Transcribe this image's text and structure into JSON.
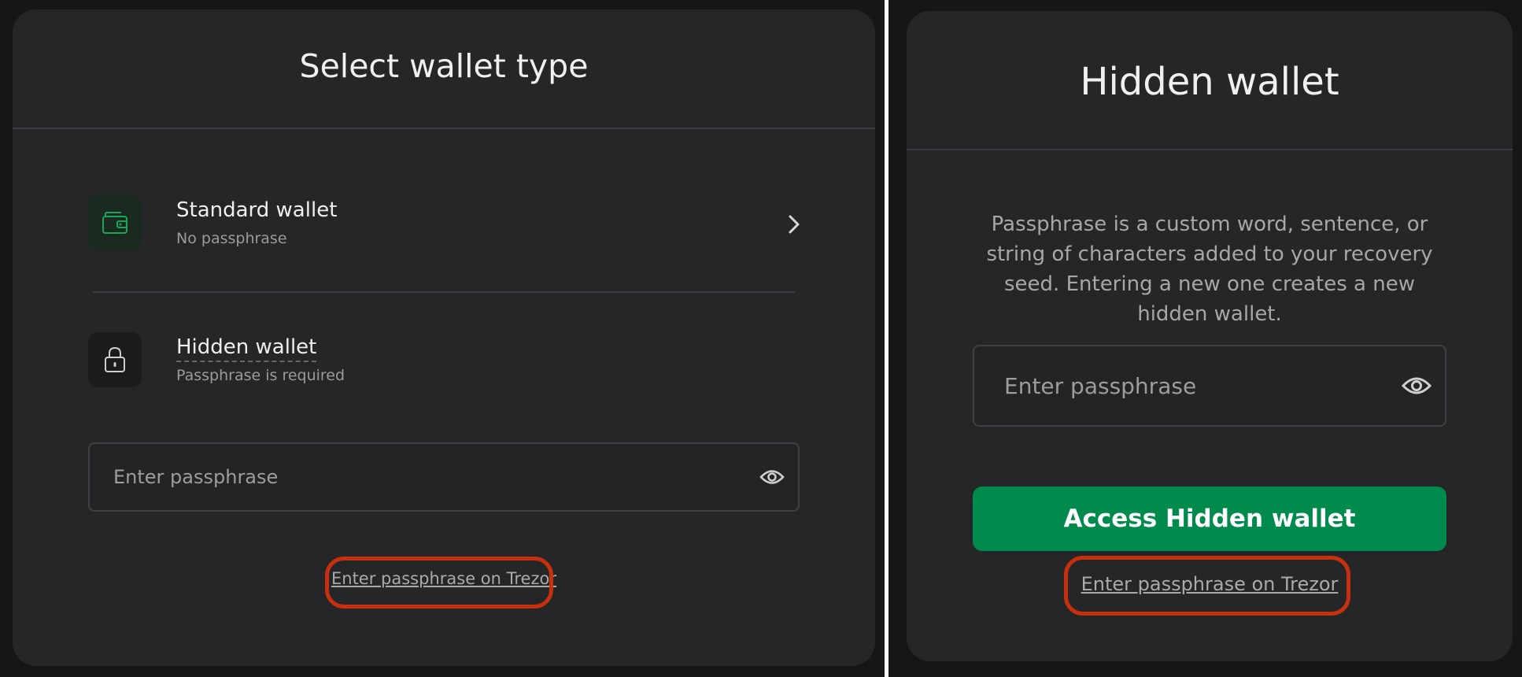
{
  "left_panel": {
    "title": "Select wallet type",
    "standard_wallet": {
      "name": "Standard wallet",
      "subtitle": "No passphrase",
      "icon": "wallet-icon"
    },
    "hidden_wallet": {
      "name": "Hidden wallet",
      "subtitle": "Passphrase is required",
      "icon": "lock-icon"
    },
    "passphrase_input": {
      "placeholder": "Enter passphrase",
      "value": ""
    },
    "trezor_link": "Enter passphrase on Trezor"
  },
  "right_panel": {
    "title": "Hidden wallet",
    "description": "Passphrase is a custom word, sentence, or string of characters added to your recovery seed. Entering a new one creates a new hidden wallet.",
    "passphrase_input": {
      "placeholder": "Enter passphrase",
      "value": ""
    },
    "access_button": "Access Hidden wallet",
    "trezor_link": "Enter passphrase on Trezor"
  },
  "colors": {
    "page_background": "#151616",
    "panel_background": "#252628",
    "accent_green": "#008a4b",
    "wallet_icon_green": "#1ea35a",
    "highlight_ring": "#c7300f"
  }
}
